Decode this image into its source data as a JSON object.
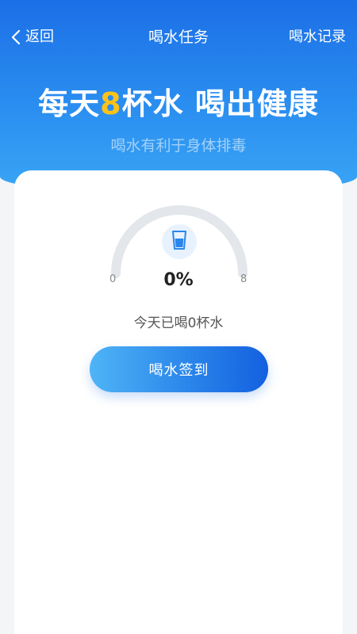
{
  "nav": {
    "back_label": "返回",
    "title": "喝水任务",
    "records_label": "喝水记录"
  },
  "hero": {
    "headline_prefix": "每天",
    "headline_number": "8",
    "headline_suffix": "杯水 喝出健康",
    "subtitle": "喝水有利于身体排毒"
  },
  "progress": {
    "min_label": "0",
    "max_label": "8",
    "percent_label": "0%",
    "cups_drunk": 0,
    "cups_goal": 8,
    "today_text": "今天已喝0杯水"
  },
  "actions": {
    "checkin_label": "喝水签到"
  },
  "colors": {
    "primary_blue": "#1c6fe6",
    "accent_yellow": "#ffc21a",
    "track_gray": "#e3e6ea",
    "progress_blue": "#2a86ea"
  },
  "icons": {
    "back": "chevron-left-icon",
    "cup": "water-cup-icon"
  }
}
